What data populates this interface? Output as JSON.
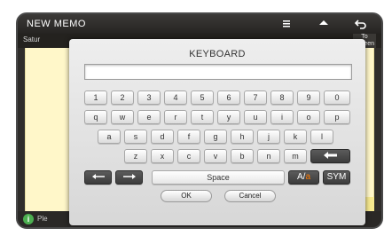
{
  "app": {
    "title": "NEW MEMO",
    "subtitle_date": "Satur",
    "to_screen": "To\nScreen",
    "bottom_text": "Ple"
  },
  "keyboard": {
    "title": "KEYBOARD",
    "input_value": "",
    "row1": [
      "1",
      "2",
      "3",
      "4",
      "5",
      "6",
      "7",
      "8",
      "9",
      "0"
    ],
    "row2": [
      "q",
      "w",
      "e",
      "r",
      "t",
      "y",
      "u",
      "i",
      "o",
      "p"
    ],
    "row3": [
      "a",
      "s",
      "d",
      "f",
      "g",
      "h",
      "j",
      "k",
      "l"
    ],
    "row4": [
      "z",
      "x",
      "c",
      "v",
      "b",
      "n",
      "m"
    ],
    "space_label": "Space",
    "case_toggle": {
      "upper": "A",
      "sep": "/",
      "lower": "a"
    },
    "sym_label": "SYM",
    "ok_label": "OK",
    "cancel_label": "Cancel"
  },
  "icons": {
    "back": "back-arrow-icon",
    "backspace": "backspace-icon",
    "cursor_left": "left-arrow-icon",
    "cursor_right": "right-arrow-icon",
    "info": "info-icon"
  },
  "colors": {
    "accent_orange": "#ff7a00",
    "note_yellow": "#fff7c9",
    "info_green": "#4caf50"
  }
}
